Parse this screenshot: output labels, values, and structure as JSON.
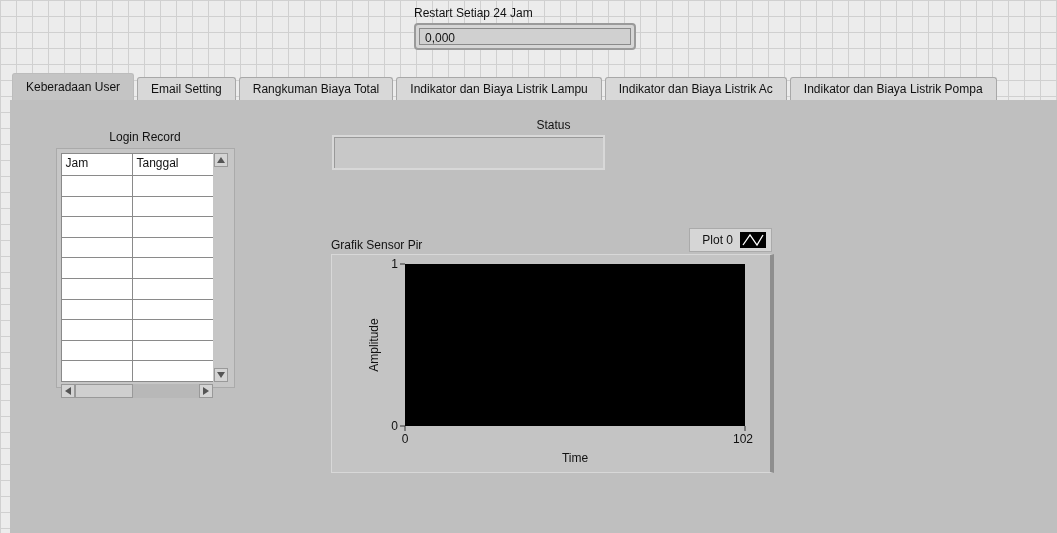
{
  "restart": {
    "label": "Restart Setiap 24 Jam",
    "value": "0,000"
  },
  "tabs": [
    {
      "label": "Keberadaan User",
      "selected": true
    },
    {
      "label": "Email Setting",
      "selected": false
    },
    {
      "label": "Rangkuman Biaya Total",
      "selected": false
    },
    {
      "label": "Indikator dan Biaya Listrik Lampu",
      "selected": false
    },
    {
      "label": "Indikator dan Biaya Listrik Ac",
      "selected": false
    },
    {
      "label": "Indikator dan Biaya Listrik Pompa",
      "selected": false
    }
  ],
  "login_record": {
    "title": "Login Record",
    "columns": [
      "Jam",
      "Tanggal"
    ]
  },
  "status": {
    "label": "Status"
  },
  "graph": {
    "legend": "Plot 0",
    "chart_data": {
      "type": "line",
      "title": "Grafik Sensor Pir",
      "xlabel": "Time",
      "ylabel": "Amplitude",
      "xlim": [
        0,
        102
      ],
      "ylim": [
        0,
        1
      ],
      "xticks": [
        0,
        102
      ],
      "yticks": [
        0,
        1
      ]
    }
  }
}
